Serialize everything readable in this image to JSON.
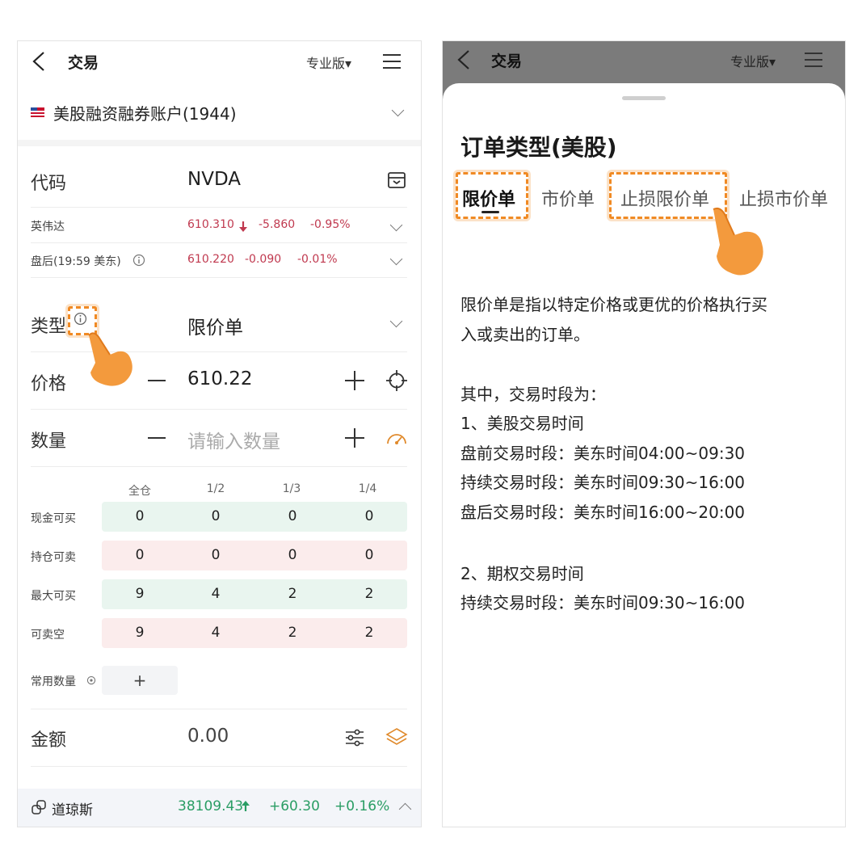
{
  "left": {
    "nav": {
      "title": "交易",
      "pro_label": "专业版▾"
    },
    "account": {
      "label": "美股融资融券账户(1944)"
    },
    "code": {
      "label": "代码",
      "value": "NVDA"
    },
    "quote1": {
      "name": "英伟达",
      "price": "610.310",
      "change": "-5.860",
      "pct": "-0.95%"
    },
    "quote2": {
      "name": "盘后(19:59 美东)",
      "price": "610.220",
      "change": "-0.090",
      "pct": "-0.01%"
    },
    "type": {
      "label": "类型",
      "value": "限价单"
    },
    "price": {
      "label": "价格",
      "value": "610.22"
    },
    "quantity": {
      "label": "数量",
      "placeholder": "请输入数量"
    },
    "grid": {
      "headers": [
        "全仓",
        "1/2",
        "1/3",
        "1/4"
      ],
      "rows": [
        {
          "label": "现金可买",
          "values": [
            "0",
            "0",
            "0",
            "0"
          ]
        },
        {
          "label": "持仓可卖",
          "values": [
            "0",
            "0",
            "0",
            "0"
          ]
        },
        {
          "label": "最大可买",
          "values": [
            "9",
            "4",
            "2",
            "2"
          ]
        },
        {
          "label": "可卖空",
          "values": [
            "9",
            "4",
            "2",
            "2"
          ]
        }
      ]
    },
    "common_qty": {
      "label": "常用数量",
      "add": "+"
    },
    "amount": {
      "label": "金额",
      "value": "0.00"
    },
    "ticker": {
      "name": "道琼斯",
      "price": "38109.43",
      "change": "+60.30",
      "pct": "+0.16%"
    }
  },
  "right": {
    "nav": {
      "title": "交易",
      "pro_label": "专业版▾"
    },
    "sheet_title": "订单类型(美股)",
    "tabs": [
      "限价单",
      "市价单",
      "止损限价单",
      "止损市价单"
    ],
    "description": [
      "限价单是指以特定价格或更优的价格执行买",
      "入或卖出的订单。",
      "",
      "其中，交易时段为：",
      "1、美股交易时间",
      "盘前交易时段：美东时间04:00~09:30",
      "持续交易时段：美东时间09:30~16:00",
      "盘后交易时段：美东时间16:00~20:00",
      "",
      "2、期权交易时间",
      "持续交易时段：美东时间09:30~16:00"
    ]
  },
  "colors": {
    "accent": "#f08a24",
    "down": "#c0394f",
    "up": "#2a9d64",
    "green_row": "#e9f5ef",
    "pink_row": "#fbecec"
  },
  "icons": [
    "back-icon",
    "menu-icon",
    "chevron-down-icon",
    "lock-box-icon",
    "info-icon",
    "down-arrow-icon",
    "crosshair-icon",
    "gauge-icon",
    "filter-icon",
    "layers-icon",
    "link-icon",
    "up-arrow-icon",
    "chevron-up-icon",
    "pointing-hand-icon"
  ]
}
